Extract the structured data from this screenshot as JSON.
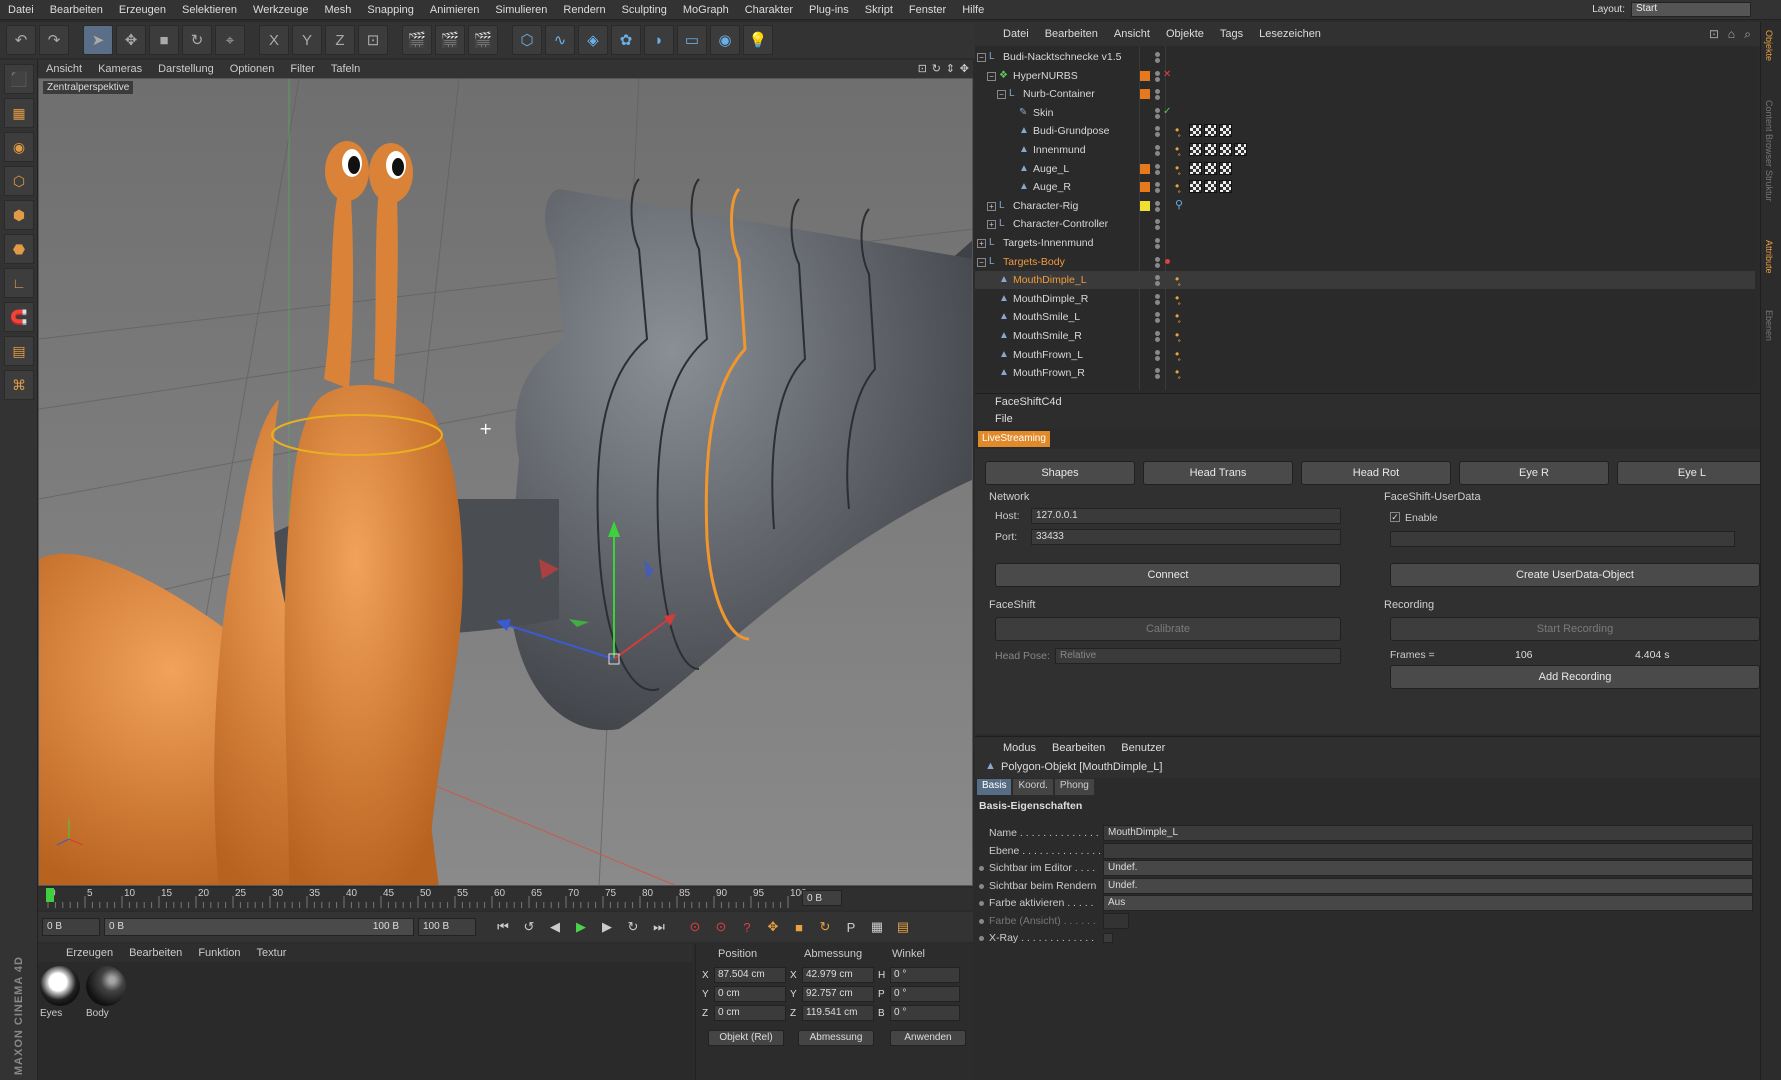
{
  "menubar": {
    "items": [
      "Datei",
      "Bearbeiten",
      "Erzeugen",
      "Selektieren",
      "Werkzeuge",
      "Mesh",
      "Snapping",
      "Animieren",
      "Simulieren",
      "Rendern",
      "Sculpting",
      "MoGraph",
      "Charakter",
      "Plug-ins",
      "Skript",
      "Fenster",
      "Hilfe"
    ],
    "layout_label": "Layout:",
    "layout_value": "Start"
  },
  "toolbar": {
    "icons": [
      "undo-icon",
      "redo-icon",
      "select-arrow-icon",
      "move-icon",
      "scale-icon",
      "rotate-icon",
      "live-select-icon",
      "x-axis-icon",
      "y-axis-icon",
      "z-axis-icon",
      "coord-system-icon",
      "render-view-icon",
      "render-picture-viewer-icon",
      "render-settings-icon",
      "cube-icon",
      "spline-icon",
      "nurbs-icon",
      "array-icon",
      "deformer-icon",
      "floor-icon",
      "camera-icon",
      "light-icon"
    ],
    "glyphs": [
      "↶",
      "↷",
      "➤",
      "✥",
      "■",
      "↻",
      "⌖",
      "X",
      "Y",
      "Z",
      "⊡",
      "🎬",
      "🎬",
      "🎬",
      "⬡",
      "∿",
      "◈",
      "✿",
      "◗",
      "▭",
      "◉",
      "💡"
    ]
  },
  "lefttools": {
    "glyphs": [
      "⬛",
      "▦",
      "◉",
      "⬡",
      "⬢",
      "⬣",
      "∟",
      "🧲",
      "▤",
      "⌘"
    ],
    "icons": [
      "model-mode-icon",
      "texture-mode-icon",
      "workplane-icon",
      "points-mode-icon",
      "edges-mode-icon",
      "polygons-mode-icon",
      "axis-mode-icon",
      "snap-magnet-icon",
      "grid-icon",
      "solo-icon"
    ]
  },
  "maxon": "MAXON CINEMA 4D",
  "viewport": {
    "menu": [
      "Ansicht",
      "Kameras",
      "Darstellung",
      "Optionen",
      "Filter",
      "Tafeln"
    ],
    "label": "Zentralperspektive"
  },
  "timeline": {
    "ticks": [
      "0",
      "5",
      "10",
      "15",
      "20",
      "25",
      "30",
      "35",
      "40",
      "45",
      "50",
      "55",
      "60",
      "65",
      "70",
      "75",
      "80",
      "85",
      "90",
      "95",
      "100"
    ],
    "end_label": "0 B"
  },
  "transport": {
    "start": "0 B",
    "current": "0 B",
    "range_end": "100 B",
    "end": "100 B"
  },
  "materials": {
    "menu": [
      "Erzeugen",
      "Bearbeiten",
      "Funktion",
      "Textur"
    ],
    "items": [
      {
        "name": "Eyes"
      },
      {
        "name": "Body"
      }
    ]
  },
  "coords": {
    "headers": [
      "Position",
      "Abmessung",
      "Winkel"
    ],
    "rows": [
      {
        "axis": "X",
        "pos": "87.504 cm",
        "size_axis": "X",
        "size": "42.979 cm",
        "rot_axis": "H",
        "rot": "0 °"
      },
      {
        "axis": "Y",
        "pos": "0 cm",
        "size_axis": "Y",
        "size": "92.757 cm",
        "rot_axis": "P",
        "rot": "0 °"
      },
      {
        "axis": "Z",
        "pos": "0 cm",
        "size_axis": "Z",
        "size": "119.541 cm",
        "rot_axis": "B",
        "rot": "0 °"
      }
    ],
    "mode": "Objekt (Rel)",
    "size_mode": "Abmessung",
    "apply": "Anwenden"
  },
  "objmgr": {
    "menu": [
      "Datei",
      "Bearbeiten",
      "Ansicht",
      "Objekte",
      "Tags",
      "Lesezeichen"
    ],
    "objects": [
      {
        "name": "Budi-Nacktschnecke v1.5",
        "icon": "null-icon",
        "orange": false,
        "layer": "",
        "tags": 0
      },
      {
        "name": "HyperNURBS",
        "icon": "hypernurbs-icon",
        "orange": false,
        "layer": "#e8781e",
        "tags": 0
      },
      {
        "name": "Nurb-Container",
        "icon": "null-icon",
        "orange": false,
        "layer": "#e8781e",
        "tags": 0
      },
      {
        "name": "Skin",
        "icon": "skin-icon",
        "orange": false,
        "layer": "",
        "tags": 0
      },
      {
        "name": "Budi-Grundpose",
        "icon": "polygon-icon",
        "orange": false,
        "layer": "",
        "tags": 3
      },
      {
        "name": "Innenmund",
        "icon": "polygon-icon",
        "orange": false,
        "layer": "",
        "tags": 4
      },
      {
        "name": "Auge_L",
        "icon": "polygon-icon",
        "orange": false,
        "layer": "#e8781e",
        "tags": 3
      },
      {
        "name": "Auge_R",
        "icon": "polygon-icon",
        "orange": false,
        "layer": "#e8781e",
        "tags": 3
      },
      {
        "name": "Character-Rig",
        "icon": "null-icon",
        "orange": false,
        "layer": "#f0e030",
        "tags": 0
      },
      {
        "name": "Character-Controller",
        "icon": "null-icon",
        "orange": false,
        "layer": "",
        "tags": 0
      },
      {
        "name": "Targets-Innenmund",
        "icon": "null-icon",
        "orange": false,
        "layer": "",
        "tags": 0
      },
      {
        "name": "Targets-Body",
        "icon": "null-icon",
        "orange": true,
        "layer": "",
        "tags": 0
      },
      {
        "name": "MouthDimple_L",
        "icon": "polygon-icon",
        "orange": true,
        "layer": "",
        "tags": 0
      },
      {
        "name": "MouthDimple_R",
        "icon": "polygon-icon",
        "orange": false,
        "layer": "",
        "tags": 0
      },
      {
        "name": "MouthSmile_L",
        "icon": "polygon-icon",
        "orange": false,
        "layer": "",
        "tags": 0
      },
      {
        "name": "MouthSmile_R",
        "icon": "polygon-icon",
        "orange": false,
        "layer": "",
        "tags": 0
      },
      {
        "name": "MouthFrown_L",
        "icon": "polygon-icon",
        "orange": false,
        "layer": "",
        "tags": 0
      },
      {
        "name": "MouthFrown_R",
        "icon": "polygon-icon",
        "orange": false,
        "layer": "",
        "tags": 0
      }
    ]
  },
  "faceshift": {
    "title": "FaceShiftC4d",
    "file": "File",
    "tab": "LiveStreaming",
    "tabs": [
      "Shapes",
      "Head Trans",
      "Head Rot",
      "Eye R",
      "Eye L"
    ],
    "network": "Network",
    "host_label": "Host:",
    "host": "127.0.0.1",
    "port_label": "Port:",
    "port": "33433",
    "connect": "Connect",
    "userdata": "FaceShift-UserData",
    "enable": "Enable",
    "create_userdata": "Create UserData-Object",
    "faceshift": "FaceShift",
    "calibrate": "Calibrate",
    "headpose_label": "Head Pose:",
    "headpose": "Relative",
    "recording": "Recording",
    "start_recording": "Start Recording",
    "frames_label": "Frames =",
    "frames": "106",
    "seconds": "4.404 s",
    "add_recording": "Add Recording"
  },
  "attributes": {
    "menu": [
      "Modus",
      "Bearbeiten",
      "Benutzer"
    ],
    "title": "Polygon-Objekt [MouthDimple_L]",
    "tabs": [
      "Basis",
      "Koord.",
      "Phong"
    ],
    "section": "Basis-Eigenschaften",
    "rows": [
      {
        "label": "Name . . . . . . . . . . . . . .",
        "value": "MouthDimple_L"
      },
      {
        "label": "Ebene . . . . . . . . . . . . . .",
        "value": ""
      },
      {
        "label": "Sichtbar im Editor . . . .",
        "value": "Undef."
      },
      {
        "label": "Sichtbar beim Rendern",
        "value": "Undef."
      },
      {
        "label": "Farbe aktivieren . . . . .",
        "value": "Aus"
      },
      {
        "label": "Farbe (Ansicht) . . . . . .",
        "value": ""
      },
      {
        "label": "X-Ray . . . . . . . . . . . . .",
        "value": ""
      }
    ]
  },
  "rightstrip": [
    "Objekte",
    "Content Browser",
    "Struktur",
    "Attribute",
    "Ebenen"
  ]
}
